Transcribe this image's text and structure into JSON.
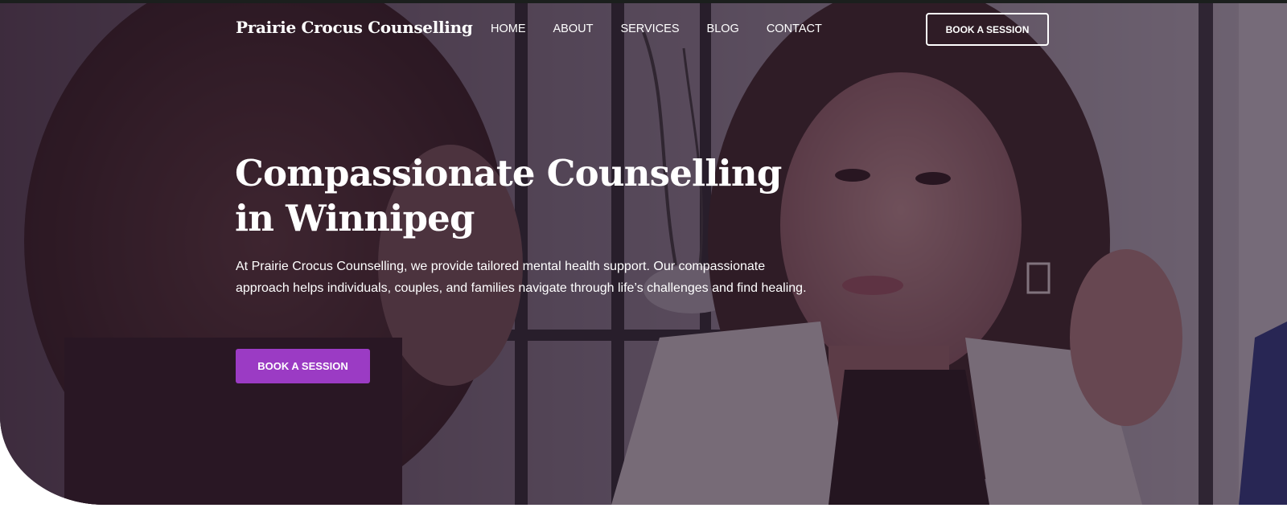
{
  "brand": {
    "name": "Prairie Crocus Counselling"
  },
  "nav": {
    "items": [
      {
        "label": "HOME"
      },
      {
        "label": "ABOUT"
      },
      {
        "label": "SERVICES"
      },
      {
        "label": "BLOG"
      },
      {
        "label": "CONTACT"
      }
    ],
    "cta_label": "BOOK A SESSION"
  },
  "hero": {
    "headline": "Compassionate Counselling in Winnipeg",
    "lead": "At Prairie Crocus Counselling, we provide tailored mental health support. Our compassionate approach helps individuals, couples, and families navigate through life’s challenges and find healing.",
    "cta_label": "BOOK A SESSION",
    "background_image": "two-women-in-conversation-photo"
  },
  "colors": {
    "accent": "#9b3bc4",
    "overlay": "#261428",
    "text": "#ffffff"
  }
}
